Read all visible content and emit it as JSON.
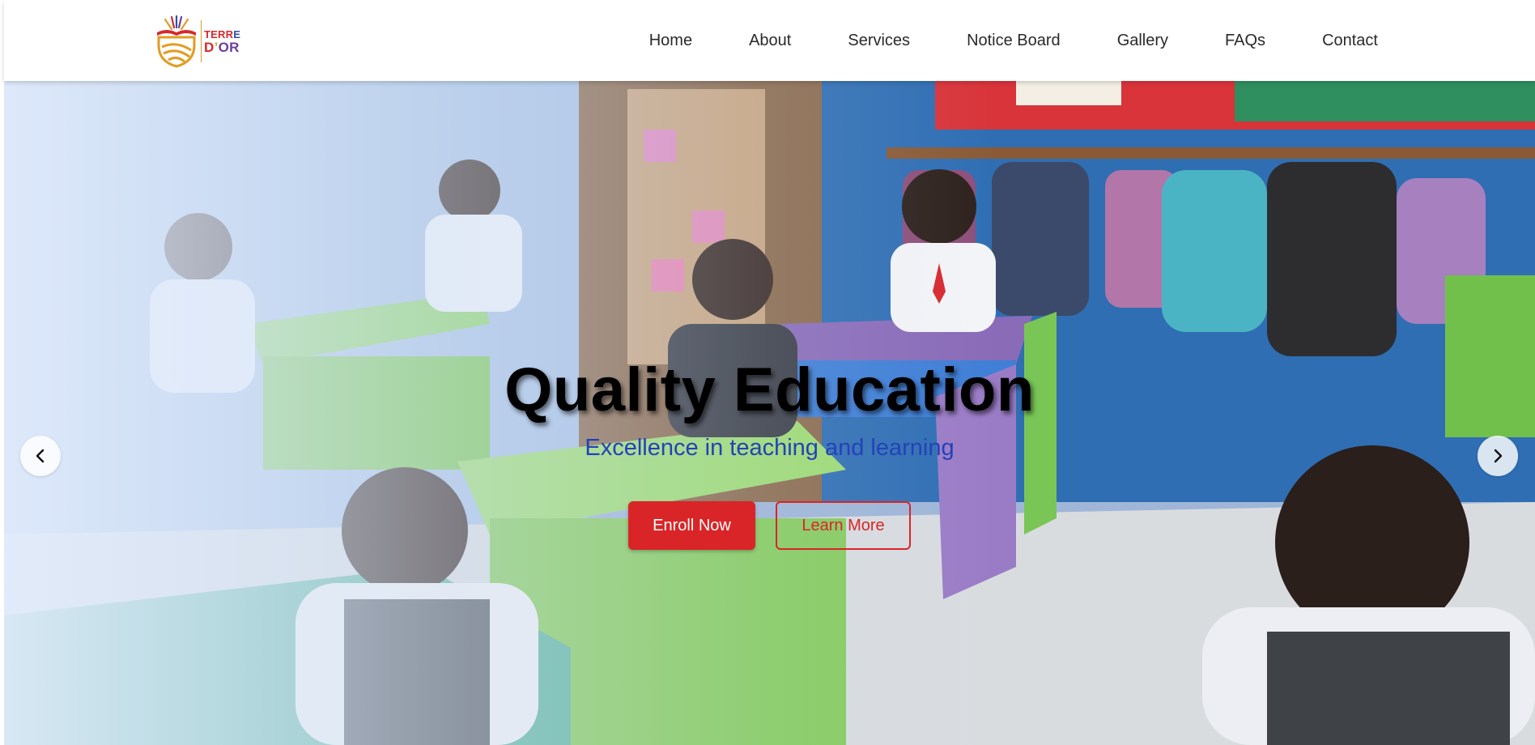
{
  "logo": {
    "line1": [
      "TERR",
      "E"
    ],
    "line2": [
      "D",
      "’",
      "OR"
    ]
  },
  "nav": {
    "items": [
      "Home",
      "About",
      "Services",
      "Notice Board",
      "Gallery",
      "FAQs",
      "Contact"
    ]
  },
  "hero": {
    "title": "Quality Education",
    "subtitle": "Excellence in teaching and learning",
    "primary_button": "Enroll Now",
    "secondary_button": "Learn More",
    "prev_icon": "chevron-left-icon",
    "next_icon": "chevron-right-icon"
  },
  "colors": {
    "brand_red": "#d92527",
    "subtitle_blue": "#2442b8",
    "nav_text": "#2a2a2a"
  }
}
